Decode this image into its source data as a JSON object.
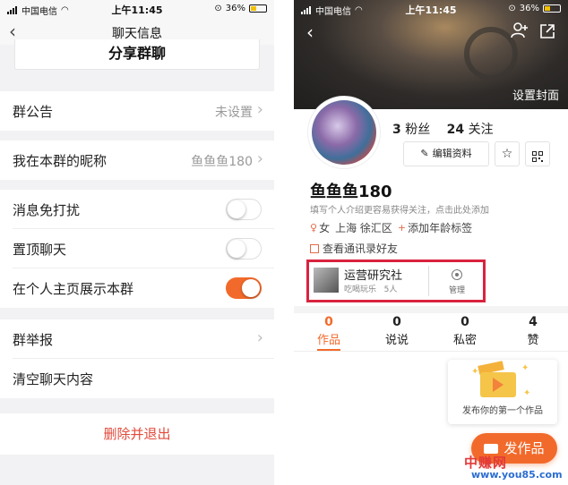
{
  "status_bar_left": {
    "carrier": "中国电信",
    "time": "上午11:45",
    "battery": "36%",
    "battery_level": 0.36
  },
  "status_bar_right": {
    "carrier": "中国电信",
    "time": "上午11:45",
    "battery": "36%",
    "battery_level": 0.36
  },
  "chat_info": {
    "title": "聊天信息",
    "share_group": "分享群聊",
    "rows": [
      {
        "label": "群公告",
        "value": "未设置",
        "chevron": true
      },
      {
        "label": "我在本群的昵称",
        "value": "鱼鱼鱼180",
        "chevron": true
      },
      {
        "label": "消息免打扰",
        "toggle": false
      },
      {
        "label": "置顶聊天",
        "toggle": false
      },
      {
        "label": "在个人主页展示本群",
        "toggle": true
      },
      {
        "label": "群举报",
        "chevron": true
      },
      {
        "label": "清空聊天内容"
      }
    ],
    "exit_label": "删除并退出"
  },
  "profile": {
    "set_cover": "设置封面",
    "followers_count": "3",
    "followers_label": "粉丝",
    "following_count": "24",
    "following_label": "关注",
    "edit_label": "编辑资料",
    "username": "鱼鱼鱼180",
    "bio_placeholder": "填写个人介绍更容易获得关注，点击此处添加",
    "gender": "女",
    "location": "上海 徐汇区",
    "add_age_tag": "添加年龄标签",
    "contacts_link": "查看通讯录好友",
    "group": {
      "name": "运营研究社",
      "category": "吃喝玩乐",
      "members": "5人",
      "manage_label": "管理"
    },
    "tabs": [
      {
        "count": "0",
        "label": "作品",
        "active": true
      },
      {
        "count": "0",
        "label": "说说",
        "active": false
      },
      {
        "count": "0",
        "label": "私密",
        "active": false
      },
      {
        "count": "4",
        "label": "赞",
        "active": false
      }
    ],
    "promo_text": "发布你的第一个作品",
    "publish_label": "发作品"
  },
  "watermark": {
    "cn": "中赚网",
    "url": "www.you85.com"
  },
  "colors": {
    "accent": "#f26a2b",
    "highlight_box": "#d9233f",
    "danger_text": "#e24a3b"
  }
}
